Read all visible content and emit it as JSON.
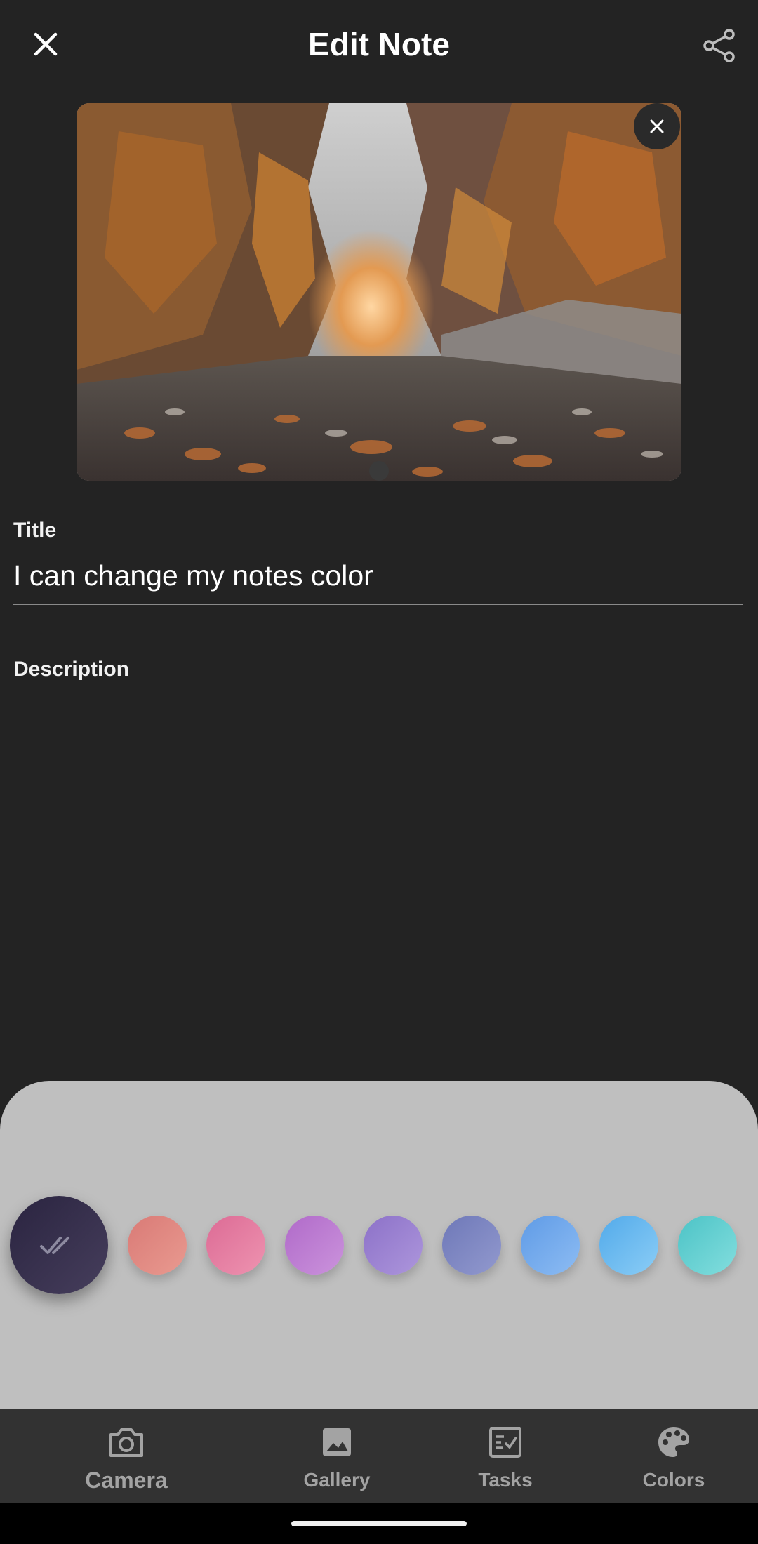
{
  "header": {
    "title": "Edit Note",
    "close_icon": "close-icon",
    "share_icon": "share-icon"
  },
  "image_attachment": {
    "remove_icon": "close-icon"
  },
  "form": {
    "title_label": "Title",
    "title_value": "I can change my notes color",
    "description_label": "Description",
    "description_value": ""
  },
  "color_picker": {
    "selected_icon": "double-check-icon",
    "swatches": [
      {
        "name": "dark-navy",
        "gradient": [
          "#2a2440",
          "#463e5c"
        ],
        "selected": true
      },
      {
        "name": "coral",
        "gradient": [
          "#d97a76",
          "#e99a90"
        ]
      },
      {
        "name": "pink",
        "gradient": [
          "#dc6b95",
          "#ee93b0"
        ]
      },
      {
        "name": "purple",
        "gradient": [
          "#b06ac9",
          "#cb93dc"
        ]
      },
      {
        "name": "violet",
        "gradient": [
          "#8c71c8",
          "#ad96dc"
        ]
      },
      {
        "name": "indigo",
        "gradient": [
          "#6e78b8",
          "#9299ce"
        ]
      },
      {
        "name": "blue",
        "gradient": [
          "#5f9be6",
          "#8dbcf3"
        ]
      },
      {
        "name": "light-blue",
        "gradient": [
          "#52aaea",
          "#8bcdf6"
        ]
      },
      {
        "name": "teal",
        "gradient": [
          "#4cc3c6",
          "#83dede"
        ]
      }
    ]
  },
  "bottom_nav": {
    "items": [
      {
        "label": "Camera",
        "icon": "camera-icon"
      },
      {
        "label": "Gallery",
        "icon": "image-icon"
      },
      {
        "label": "Tasks",
        "icon": "checklist-icon"
      },
      {
        "label": "Colors",
        "icon": "palette-icon"
      }
    ],
    "text_color": "#a3a3a3",
    "background": "#323232"
  },
  "colors": {
    "background": "#232323",
    "sheet": "#bfbfbf"
  }
}
